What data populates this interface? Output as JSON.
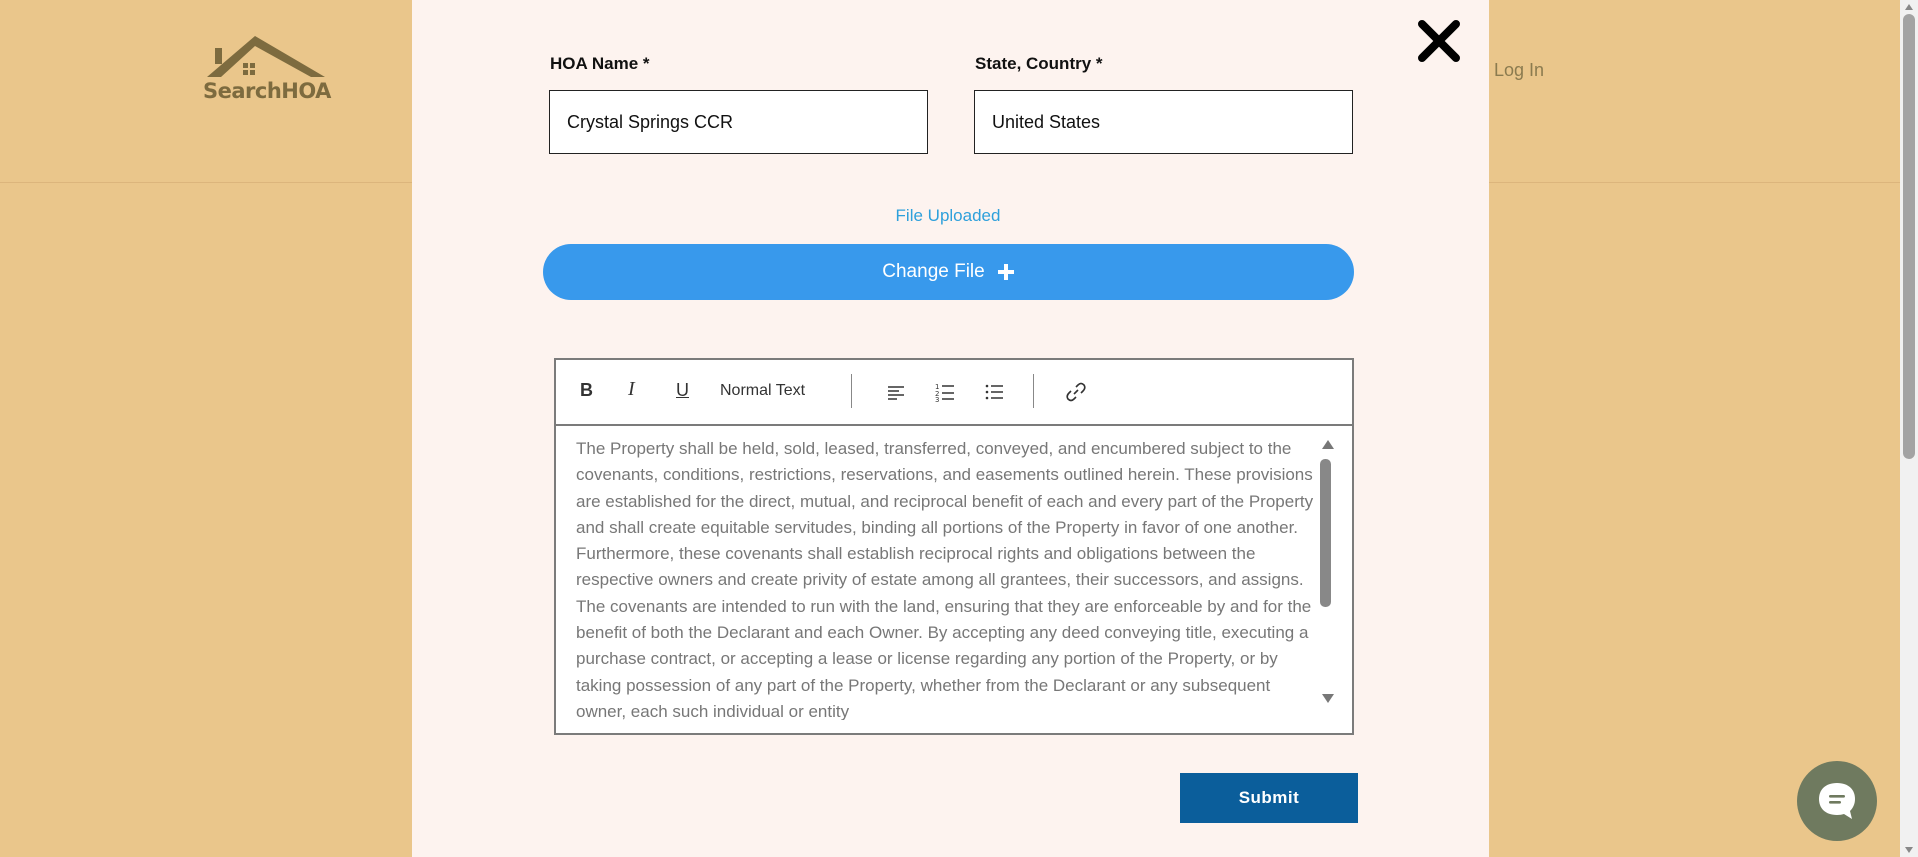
{
  "header": {
    "logo_text": "SearchHOA",
    "login_label": "Log In"
  },
  "form": {
    "hoa_name_label": "HOA Name *",
    "hoa_name_value": "Crystal Springs CCR",
    "state_label": "State, Country *",
    "state_value": "United States",
    "file_status": "File Uploaded",
    "change_file_label": "Change File",
    "submit_label": "Submit"
  },
  "editor": {
    "bold": "B",
    "italic": "I",
    "underline": "U",
    "text_style": "Normal Text",
    "content": "The Property shall be held, sold, leased, transferred, conveyed, and encumbered subject to the covenants, conditions, restrictions, reservations, and easements outlined herein. These provisions are established for the direct, mutual, and reciprocal benefit of each and every part of the Property and shall create equitable servitudes, binding all portions of the Property in favor of one another. Furthermore, these covenants shall establish reciprocal rights and obligations between the respective owners and create privity of estate among all grantees, their successors, and assigns. The covenants are intended to run with the land, ensuring that they are enforceable by and for the benefit of both the Declarant and each Owner. By accepting any deed conveying title, executing a purchase contract, or accepting a lease or license regarding any portion of the Property, or by taking possession of any part of the Property, whether from the Declarant or any subsequent owner, each such individual or entity"
  },
  "colors": {
    "page_bg": "#eac68b",
    "modal_bg": "#fdf3ef",
    "change_button": "#3899ec",
    "submit_button": "#0b5e9b",
    "uploaded_text": "#2ea0db",
    "chat_bubble": "#6f7a5f"
  },
  "icons": [
    "house-logo-icon",
    "close-icon",
    "plus-icon",
    "align-left-icon",
    "numbered-list-icon",
    "bulleted-list-icon",
    "link-icon",
    "chat-icon"
  ]
}
